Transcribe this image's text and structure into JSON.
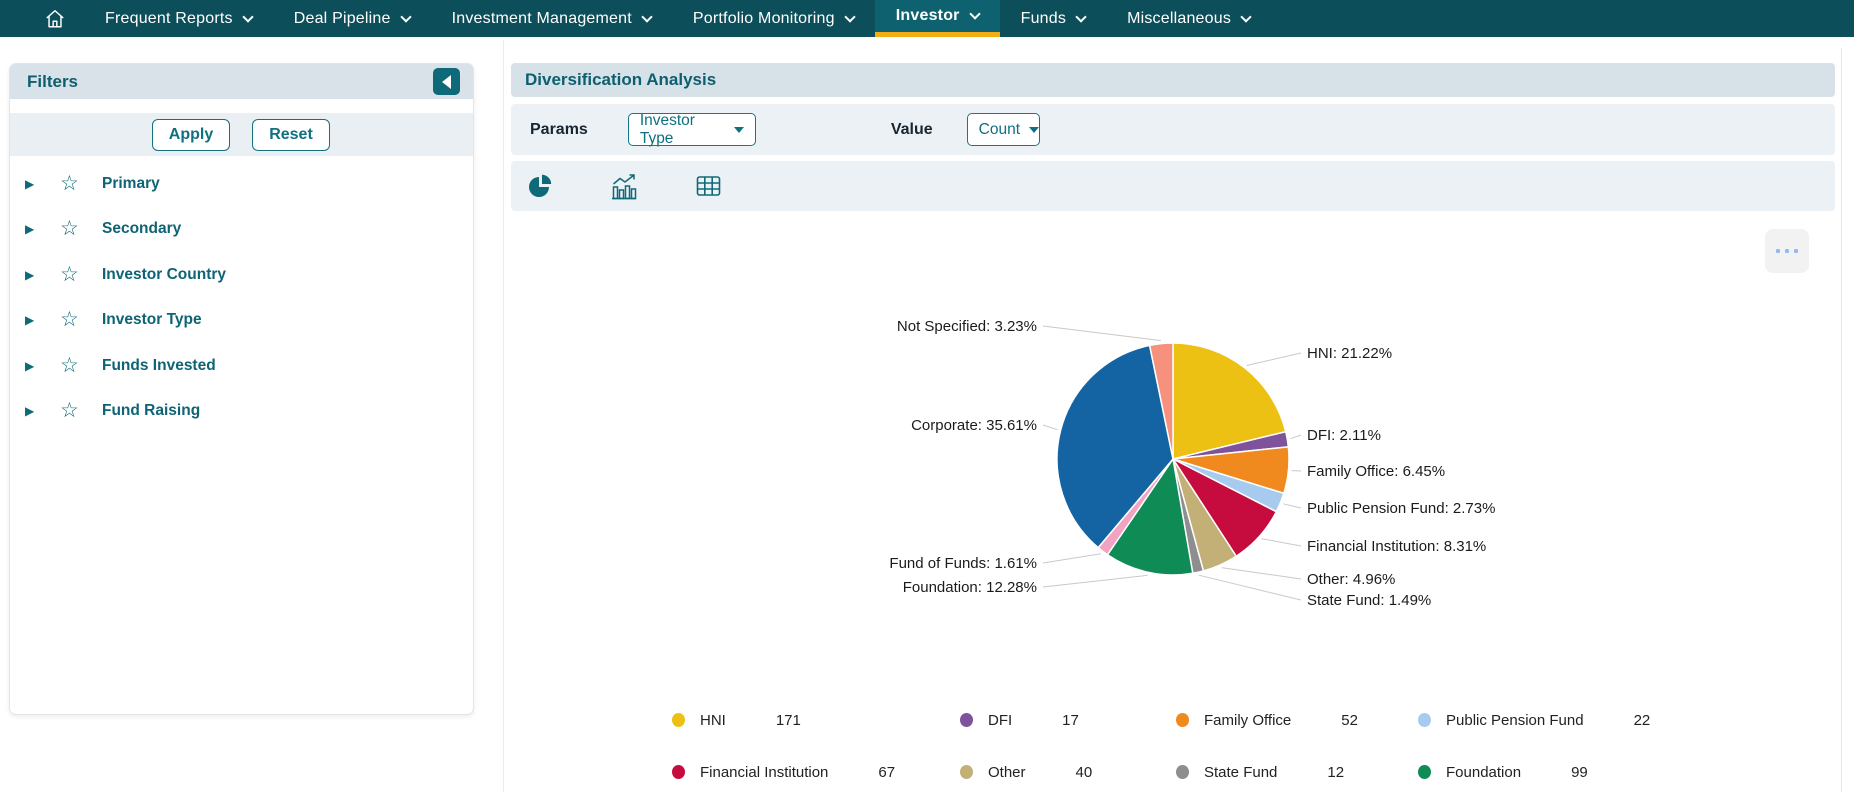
{
  "nav": {
    "items": [
      {
        "label": "Frequent Reports"
      },
      {
        "label": "Deal Pipeline"
      },
      {
        "label": "Investment Management"
      },
      {
        "label": "Portfolio Monitoring"
      },
      {
        "label": "Investor",
        "active": true
      },
      {
        "label": "Funds"
      },
      {
        "label": "Miscellaneous"
      }
    ]
  },
  "sidebar": {
    "title": "Filters",
    "apply_label": "Apply",
    "reset_label": "Reset",
    "items": [
      {
        "label": "Primary"
      },
      {
        "label": "Secondary"
      },
      {
        "label": "Investor Country"
      },
      {
        "label": "Investor Type"
      },
      {
        "label": "Funds Invested"
      },
      {
        "label": "Fund Raising"
      }
    ]
  },
  "main": {
    "title": "Diversification Analysis",
    "params_label": "Params",
    "params_value": "Investor Type",
    "value_label": "Value",
    "value_value": "Count"
  },
  "chart_data": {
    "type": "pie",
    "title": "Diversification Analysis",
    "value_mode": "Count",
    "slices": [
      {
        "name": "HNI",
        "pct": 21.22,
        "color": "#ecc113"
      },
      {
        "name": "DFI",
        "pct": 2.11,
        "color": "#7f539b"
      },
      {
        "name": "Family Office",
        "pct": 6.45,
        "color": "#f08a1e"
      },
      {
        "name": "Public Pension Fund",
        "pct": 2.73,
        "color": "#a6cbee"
      },
      {
        "name": "Financial Institution",
        "pct": 8.31,
        "color": "#c60b3f"
      },
      {
        "name": "Other",
        "pct": 4.96,
        "color": "#c2b077"
      },
      {
        "name": "State Fund",
        "pct": 1.49,
        "color": "#8e8e8e"
      },
      {
        "name": "Foundation",
        "pct": 12.28,
        "color": "#0f8c55"
      },
      {
        "name": "Fund of Funds",
        "pct": 1.61,
        "color": "#f2a3c4"
      },
      {
        "name": "Corporate",
        "pct": 35.61,
        "color": "#1463a3"
      },
      {
        "name": "Not Specified",
        "pct": 3.23,
        "color": "#f5917c"
      }
    ],
    "legend": [
      {
        "name": "HNI",
        "count": 171,
        "color": "#ecc113"
      },
      {
        "name": "DFI",
        "count": 17,
        "color": "#7f539b"
      },
      {
        "name": "Family Office",
        "count": 52,
        "color": "#f08a1e"
      },
      {
        "name": "Public Pension Fund",
        "count": 22,
        "color": "#a6cbee"
      },
      {
        "name": "Financial Institution",
        "count": 67,
        "color": "#c60b3f"
      },
      {
        "name": "Other",
        "count": 40,
        "color": "#c2b077"
      },
      {
        "name": "State Fund",
        "count": 12,
        "color": "#8e8e8e"
      },
      {
        "name": "Foundation",
        "count": 99,
        "color": "#0f8c55"
      }
    ]
  },
  "colors": {
    "nav_bg": "#0c4e5a",
    "nav_active_bg": "#0e6270",
    "nav_underline": "#f2ac14",
    "accent_teal": "#0e6a78",
    "panel_header_bg": "#d8e2e8",
    "panel_row_bg": "#ecf1f5"
  }
}
